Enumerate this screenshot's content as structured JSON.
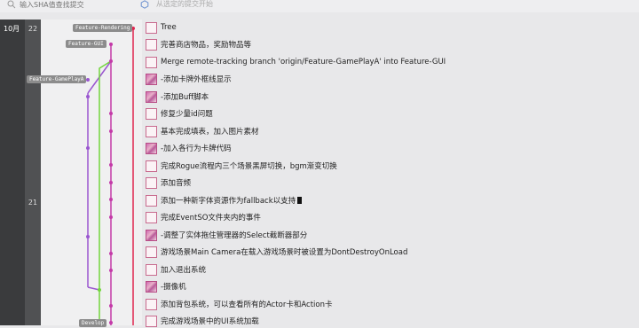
{
  "search": {
    "placeholder": "输入SHA值查找提交"
  },
  "from_selected": "从选定的提交开始",
  "month": "10月",
  "days": [
    {
      "label": "22"
    },
    {
      "label": "21"
    }
  ],
  "branches": [
    "Feature-Rendering",
    "Feature-GUI",
    "Feature-GamePlayA",
    "Develop"
  ],
  "commits": [
    {
      "message": "Tree",
      "avatar": "placeholder"
    },
    {
      "message": "完善商店物品，奖励物品等",
      "avatar": "placeholder"
    },
    {
      "message": "Merge remote-tracking branch 'origin/Feature-GamePlayA' into Feature-GUI",
      "avatar": "placeholder"
    },
    {
      "message": "-添加卡牌外框线显示",
      "avatar": "image"
    },
    {
      "message": "-添加Buff脚本",
      "avatar": "image"
    },
    {
      "message": "修复少量id问题",
      "avatar": "placeholder"
    },
    {
      "message": "基本完成填表，加入图片素材",
      "avatar": "placeholder"
    },
    {
      "message": "-加入各行为卡牌代码",
      "avatar": "image"
    },
    {
      "message": "完成Rogue流程内三个场景黑屏切换，bgm渐变切换",
      "avatar": "placeholder"
    },
    {
      "message": "添加音频",
      "avatar": "placeholder"
    },
    {
      "message": "添加一种新字体资源作为fallback以支持",
      "avatar": "placeholder"
    },
    {
      "message": "完成EventSO文件夹内的事件",
      "avatar": "placeholder"
    },
    {
      "message": "-调整了实体拖住管理器的Select截断器部分",
      "avatar": "image"
    },
    {
      "message": "游戏场景Main Camera在载入游戏场景时被设置为DontDestroyOnLoad",
      "avatar": "placeholder"
    },
    {
      "message": "加入退出系统",
      "avatar": "placeholder"
    },
    {
      "message": "-摄像机",
      "avatar": "image"
    },
    {
      "message": "添加背包系统，可以查看所有的Actor卡和Action卡",
      "avatar": "placeholder"
    },
    {
      "message": "完成游戏场景中的UI系统加载",
      "avatar": "placeholder"
    }
  ],
  "colors": {
    "rendering": "#e0264f",
    "gui": "#c43aa8",
    "gameplay": "#9a56d0",
    "develop": "#72d63c"
  }
}
